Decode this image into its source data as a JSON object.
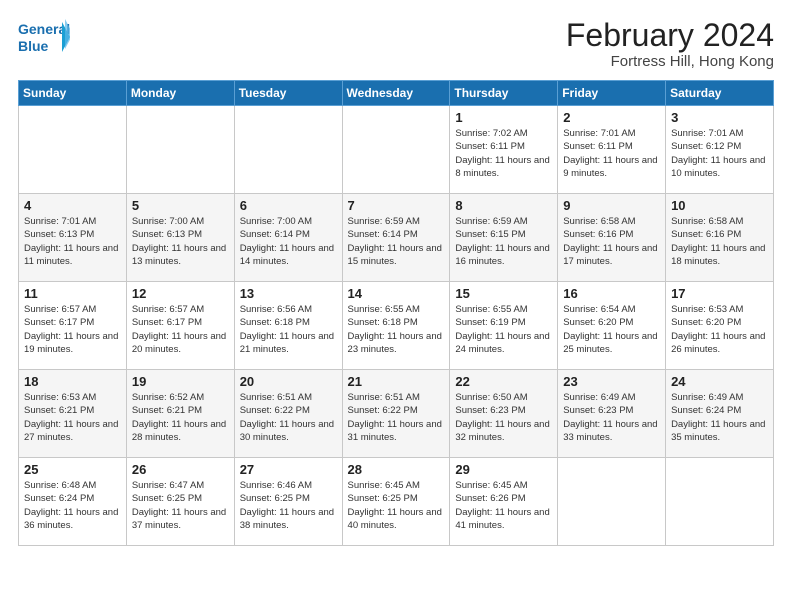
{
  "logo": {
    "line1": "General",
    "line2": "Blue"
  },
  "title": "February 2024",
  "subtitle": "Fortress Hill, Hong Kong",
  "days_of_week": [
    "Sunday",
    "Monday",
    "Tuesday",
    "Wednesday",
    "Thursday",
    "Friday",
    "Saturday"
  ],
  "weeks": [
    [
      {
        "day": "",
        "info": ""
      },
      {
        "day": "",
        "info": ""
      },
      {
        "day": "",
        "info": ""
      },
      {
        "day": "",
        "info": ""
      },
      {
        "day": "1",
        "info": "Sunrise: 7:02 AM\nSunset: 6:11 PM\nDaylight: 11 hours and 8 minutes."
      },
      {
        "day": "2",
        "info": "Sunrise: 7:01 AM\nSunset: 6:11 PM\nDaylight: 11 hours and 9 minutes."
      },
      {
        "day": "3",
        "info": "Sunrise: 7:01 AM\nSunset: 6:12 PM\nDaylight: 11 hours and 10 minutes."
      }
    ],
    [
      {
        "day": "4",
        "info": "Sunrise: 7:01 AM\nSunset: 6:13 PM\nDaylight: 11 hours and 11 minutes."
      },
      {
        "day": "5",
        "info": "Sunrise: 7:00 AM\nSunset: 6:13 PM\nDaylight: 11 hours and 13 minutes."
      },
      {
        "day": "6",
        "info": "Sunrise: 7:00 AM\nSunset: 6:14 PM\nDaylight: 11 hours and 14 minutes."
      },
      {
        "day": "7",
        "info": "Sunrise: 6:59 AM\nSunset: 6:14 PM\nDaylight: 11 hours and 15 minutes."
      },
      {
        "day": "8",
        "info": "Sunrise: 6:59 AM\nSunset: 6:15 PM\nDaylight: 11 hours and 16 minutes."
      },
      {
        "day": "9",
        "info": "Sunrise: 6:58 AM\nSunset: 6:16 PM\nDaylight: 11 hours and 17 minutes."
      },
      {
        "day": "10",
        "info": "Sunrise: 6:58 AM\nSunset: 6:16 PM\nDaylight: 11 hours and 18 minutes."
      }
    ],
    [
      {
        "day": "11",
        "info": "Sunrise: 6:57 AM\nSunset: 6:17 PM\nDaylight: 11 hours and 19 minutes."
      },
      {
        "day": "12",
        "info": "Sunrise: 6:57 AM\nSunset: 6:17 PM\nDaylight: 11 hours and 20 minutes."
      },
      {
        "day": "13",
        "info": "Sunrise: 6:56 AM\nSunset: 6:18 PM\nDaylight: 11 hours and 21 minutes."
      },
      {
        "day": "14",
        "info": "Sunrise: 6:55 AM\nSunset: 6:18 PM\nDaylight: 11 hours and 23 minutes."
      },
      {
        "day": "15",
        "info": "Sunrise: 6:55 AM\nSunset: 6:19 PM\nDaylight: 11 hours and 24 minutes."
      },
      {
        "day": "16",
        "info": "Sunrise: 6:54 AM\nSunset: 6:20 PM\nDaylight: 11 hours and 25 minutes."
      },
      {
        "day": "17",
        "info": "Sunrise: 6:53 AM\nSunset: 6:20 PM\nDaylight: 11 hours and 26 minutes."
      }
    ],
    [
      {
        "day": "18",
        "info": "Sunrise: 6:53 AM\nSunset: 6:21 PM\nDaylight: 11 hours and 27 minutes."
      },
      {
        "day": "19",
        "info": "Sunrise: 6:52 AM\nSunset: 6:21 PM\nDaylight: 11 hours and 28 minutes."
      },
      {
        "day": "20",
        "info": "Sunrise: 6:51 AM\nSunset: 6:22 PM\nDaylight: 11 hours and 30 minutes."
      },
      {
        "day": "21",
        "info": "Sunrise: 6:51 AM\nSunset: 6:22 PM\nDaylight: 11 hours and 31 minutes."
      },
      {
        "day": "22",
        "info": "Sunrise: 6:50 AM\nSunset: 6:23 PM\nDaylight: 11 hours and 32 minutes."
      },
      {
        "day": "23",
        "info": "Sunrise: 6:49 AM\nSunset: 6:23 PM\nDaylight: 11 hours and 33 minutes."
      },
      {
        "day": "24",
        "info": "Sunrise: 6:49 AM\nSunset: 6:24 PM\nDaylight: 11 hours and 35 minutes."
      }
    ],
    [
      {
        "day": "25",
        "info": "Sunrise: 6:48 AM\nSunset: 6:24 PM\nDaylight: 11 hours and 36 minutes."
      },
      {
        "day": "26",
        "info": "Sunrise: 6:47 AM\nSunset: 6:25 PM\nDaylight: 11 hours and 37 minutes."
      },
      {
        "day": "27",
        "info": "Sunrise: 6:46 AM\nSunset: 6:25 PM\nDaylight: 11 hours and 38 minutes."
      },
      {
        "day": "28",
        "info": "Sunrise: 6:45 AM\nSunset: 6:25 PM\nDaylight: 11 hours and 40 minutes."
      },
      {
        "day": "29",
        "info": "Sunrise: 6:45 AM\nSunset: 6:26 PM\nDaylight: 11 hours and 41 minutes."
      },
      {
        "day": "",
        "info": ""
      },
      {
        "day": "",
        "info": ""
      }
    ]
  ]
}
